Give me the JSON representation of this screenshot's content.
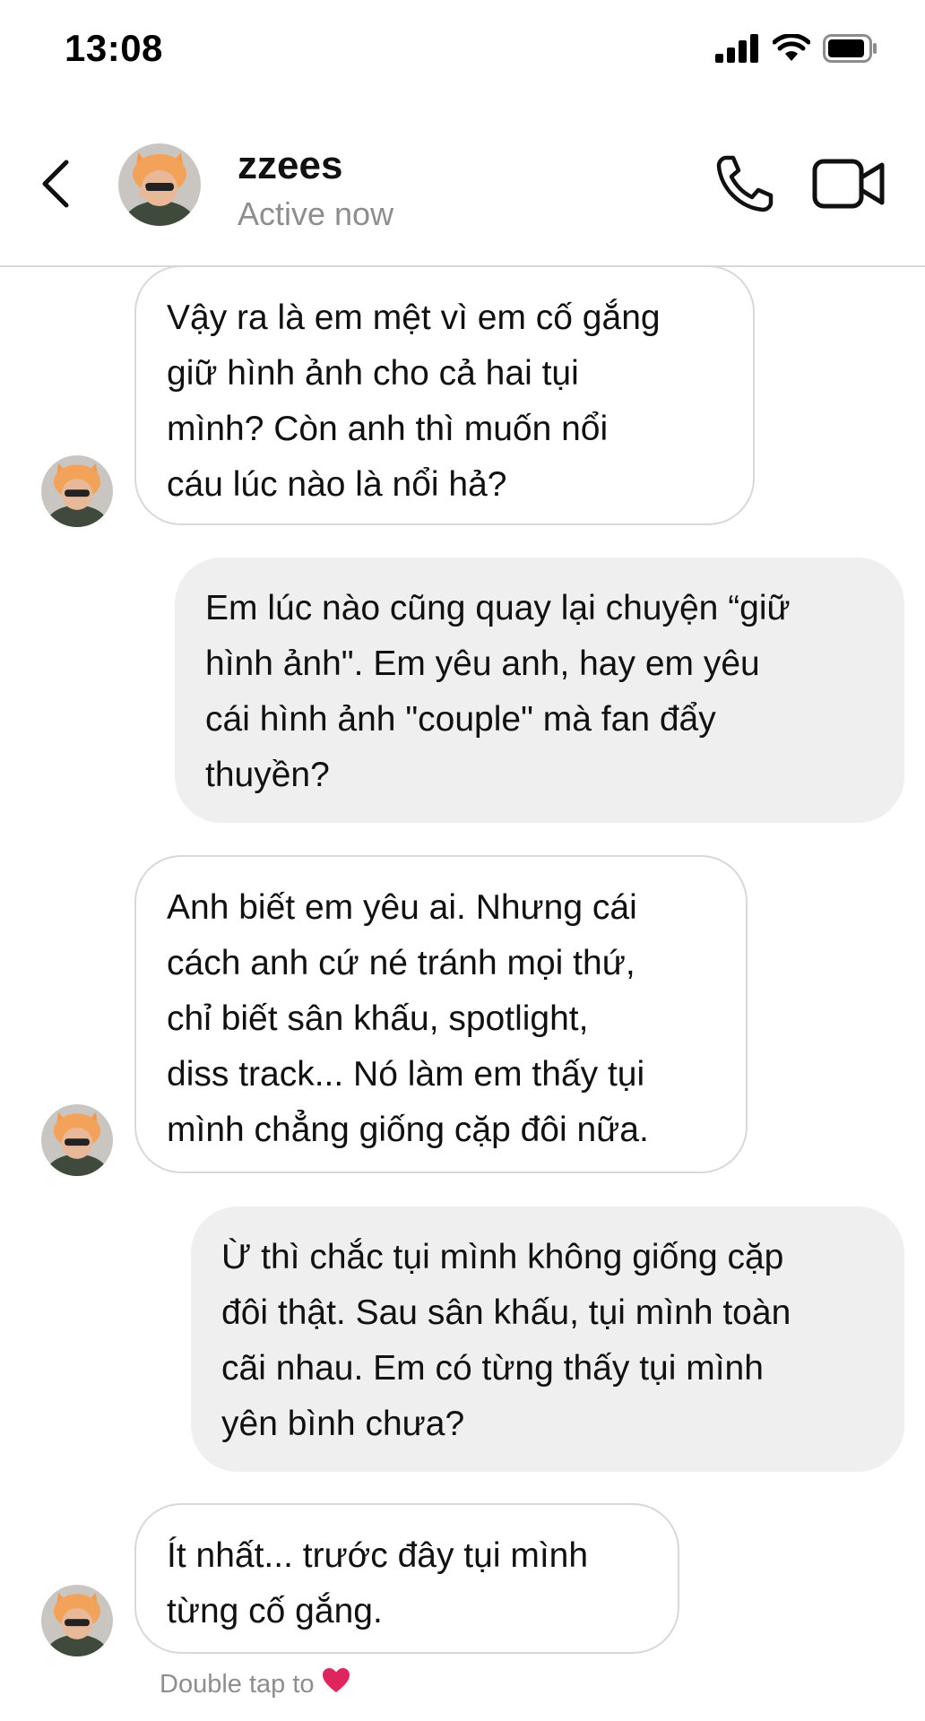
{
  "status_bar": {
    "time": "13:08",
    "icons": [
      "signal-icon",
      "wifi-icon",
      "battery-icon"
    ]
  },
  "header": {
    "contact_name": "zzees",
    "contact_status": "Active now",
    "icons": [
      "back-icon",
      "phone-icon",
      "video-icon"
    ]
  },
  "messages": [
    {
      "sender": "received",
      "text": "Vậy ra là em mệt vì em cố gắng\ngiữ hình ảnh cho cả hai tụi\nmình? Còn anh thì muốn nổi\ncáu lúc nào là nổi hả?"
    },
    {
      "sender": "sent",
      "text": "Em lúc nào cũng quay lại chuyện “giữ\nhình ảnh\". Em yêu anh, hay em yêu\ncái hình ảnh \"couple\" mà fan đẩy\nthuyền?"
    },
    {
      "sender": "received",
      "text": "Anh biết em yêu ai. Nhưng cái\ncách anh cứ né tránh mọi thứ,\nchỉ biết sân khấu, spotlight,\ndiss track... Nó làm em thấy tụi\nmình chẳng giống cặp đôi nữa."
    },
    {
      "sender": "sent",
      "text": "Ừ thì chắc tụi mình không giống cặp\nđôi thật. Sau sân khấu, tụi mình toàn\ncãi nhau. Em có từng thấy tụi mình\nyên bình chưa?"
    },
    {
      "sender": "received",
      "text": "Ít nhất... trước đây tụi mình\ntừng cố gắng."
    }
  ],
  "reaction_hint": {
    "text": "Double tap to",
    "emoji": "❤️"
  },
  "colors": {
    "sent_bubble": "#efefef",
    "received_border": "#d8d8d8",
    "muted_text": "#8e8e8e",
    "heart": "#e0245e"
  }
}
